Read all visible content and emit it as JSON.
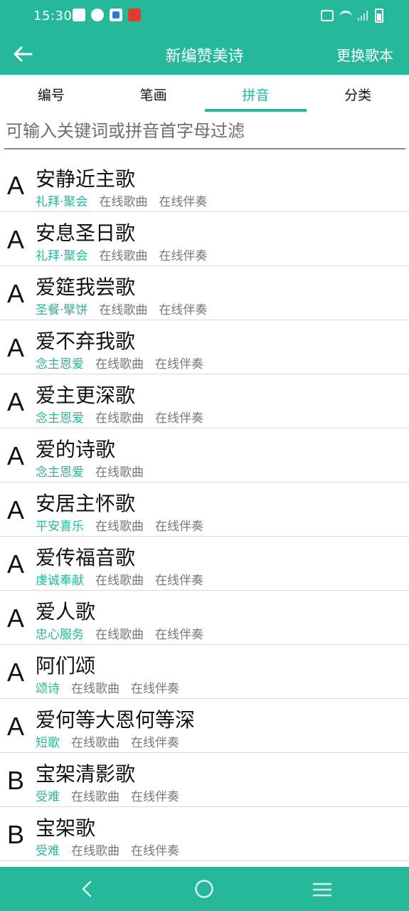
{
  "status_bar": {
    "time": "15:30"
  },
  "header": {
    "title": "新编赞美诗",
    "switch_label": "更换歌本"
  },
  "tabs": [
    {
      "label": "编号",
      "active": false
    },
    {
      "label": "笔画",
      "active": false
    },
    {
      "label": "拼音",
      "active": true
    },
    {
      "label": "分类",
      "active": false
    }
  ],
  "search": {
    "placeholder": "可输入关键词或拼音首字母过滤",
    "value": ""
  },
  "songs": [
    {
      "letter": "A",
      "title": "安静近主歌",
      "tag": "礼拜·聚会",
      "online_song": "在线歌曲",
      "online_acc": "在线伴奏"
    },
    {
      "letter": "A",
      "title": "安息圣日歌",
      "tag": "礼拜·聚会",
      "online_song": "在线歌曲",
      "online_acc": "在线伴奏"
    },
    {
      "letter": "A",
      "title": "爱筵我尝歌",
      "tag": "圣餐·擘饼",
      "online_song": "在线歌曲",
      "online_acc": "在线伴奏"
    },
    {
      "letter": "A",
      "title": "爱不弃我歌",
      "tag": "念主恩爱",
      "online_song": "在线歌曲",
      "online_acc": "在线伴奏"
    },
    {
      "letter": "A",
      "title": "爱主更深歌",
      "tag": "念主恩爱",
      "online_song": "在线歌曲",
      "online_acc": "在线伴奏"
    },
    {
      "letter": "A",
      "title": "爱的诗歌",
      "tag": "念主恩爱",
      "online_song": "在线歌曲",
      "online_acc": ""
    },
    {
      "letter": "A",
      "title": "安居主怀歌",
      "tag": "平安喜乐",
      "online_song": "在线歌曲",
      "online_acc": "在线伴奏"
    },
    {
      "letter": "A",
      "title": "爱传福音歌",
      "tag": "虔诚奉献",
      "online_song": "在线歌曲",
      "online_acc": "在线伴奏"
    },
    {
      "letter": "A",
      "title": "爱人歌",
      "tag": "忠心服务",
      "online_song": "在线歌曲",
      "online_acc": "在线伴奏"
    },
    {
      "letter": "A",
      "title": "阿们颂",
      "tag": "颂诗",
      "online_song": "在线歌曲",
      "online_acc": "在线伴奏"
    },
    {
      "letter": "A",
      "title": "爱何等大恩何等深",
      "tag": "短歌",
      "online_song": "在线歌曲",
      "online_acc": "在线伴奏"
    },
    {
      "letter": "B",
      "title": "宝架清影歌",
      "tag": "受难",
      "online_song": "在线歌曲",
      "online_acc": "在线伴奏"
    },
    {
      "letter": "B",
      "title": "宝架歌",
      "tag": "受难",
      "online_song": "在线歌曲",
      "online_acc": "在线伴奏"
    }
  ],
  "colors": {
    "accent": "#25B89A"
  }
}
